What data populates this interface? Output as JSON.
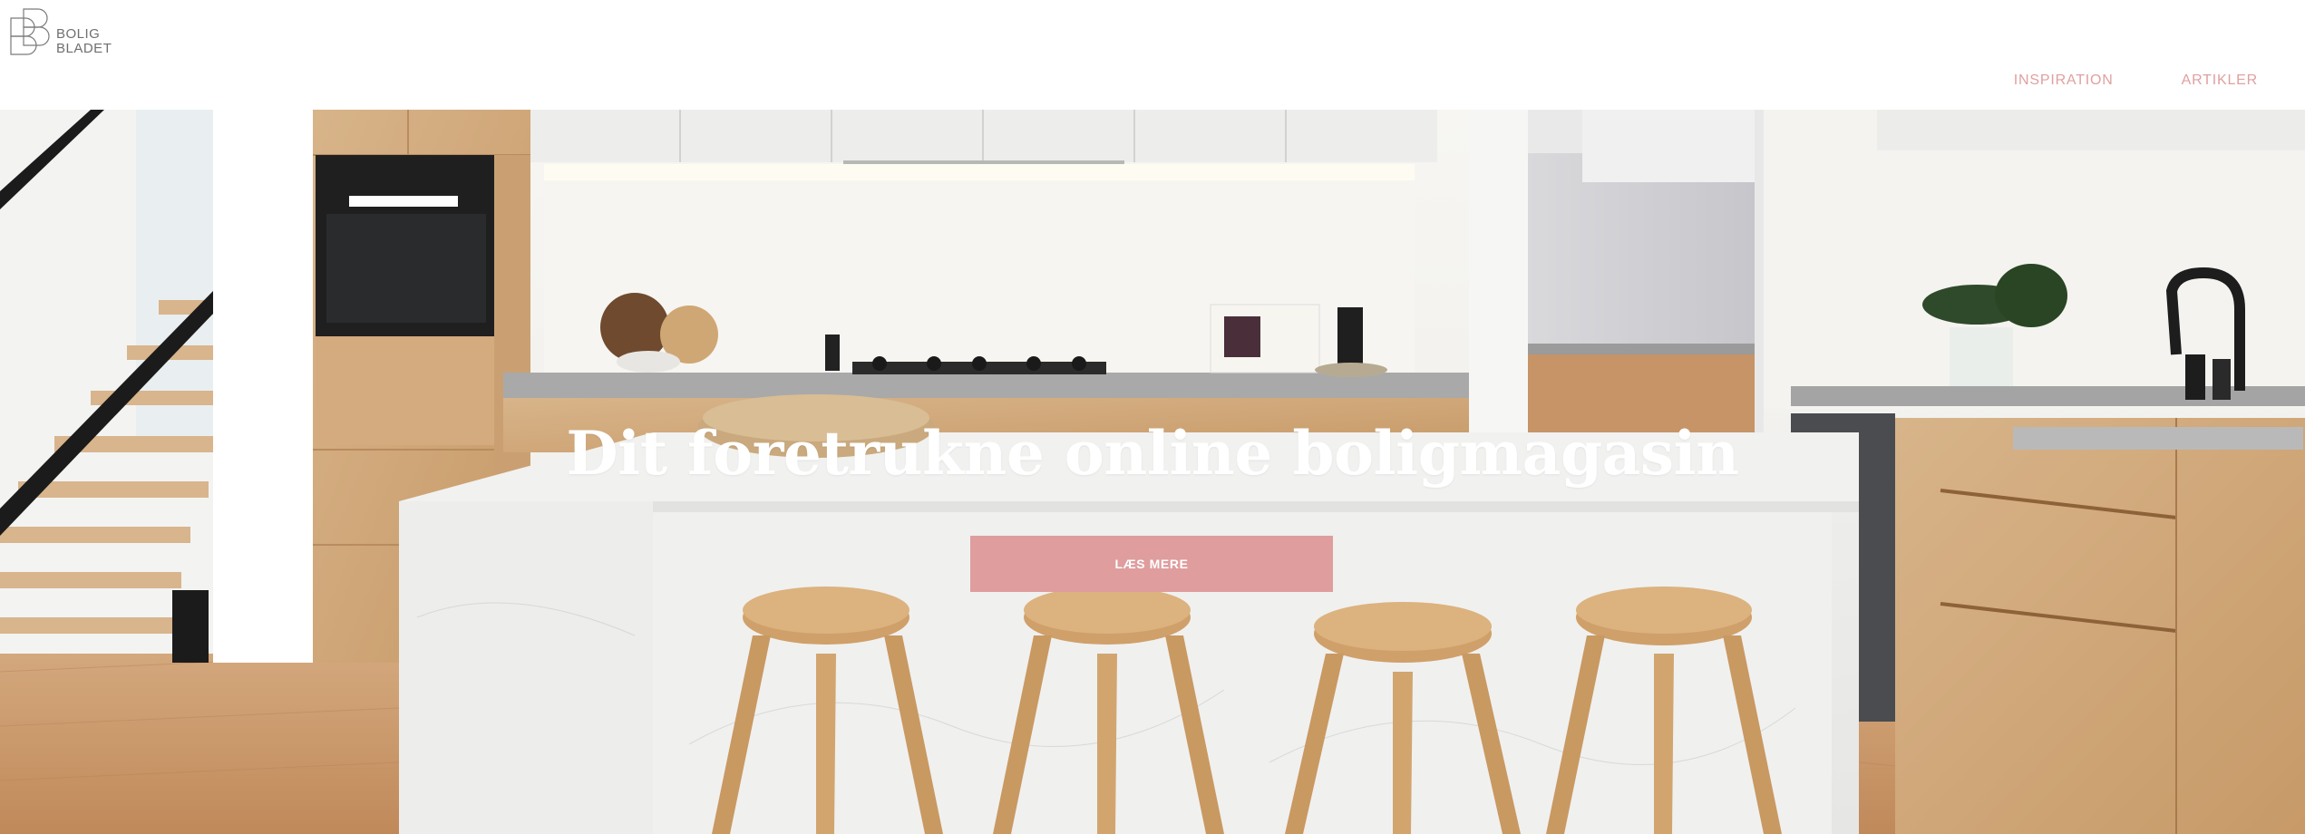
{
  "brand": {
    "line1": "BOLIG",
    "line2": "BLADET"
  },
  "nav": {
    "items": [
      {
        "label": "INSPIRATION"
      },
      {
        "label": "ARTIKLER"
      }
    ]
  },
  "hero": {
    "title": "Dit foretrukne online boligmagasin",
    "cta_label": "LÆS MERE"
  },
  "colors": {
    "accent": "#df9d9e",
    "nav_text": "#e0a0a0"
  },
  "icons": {
    "logo": "bolig-bladet-logo"
  }
}
